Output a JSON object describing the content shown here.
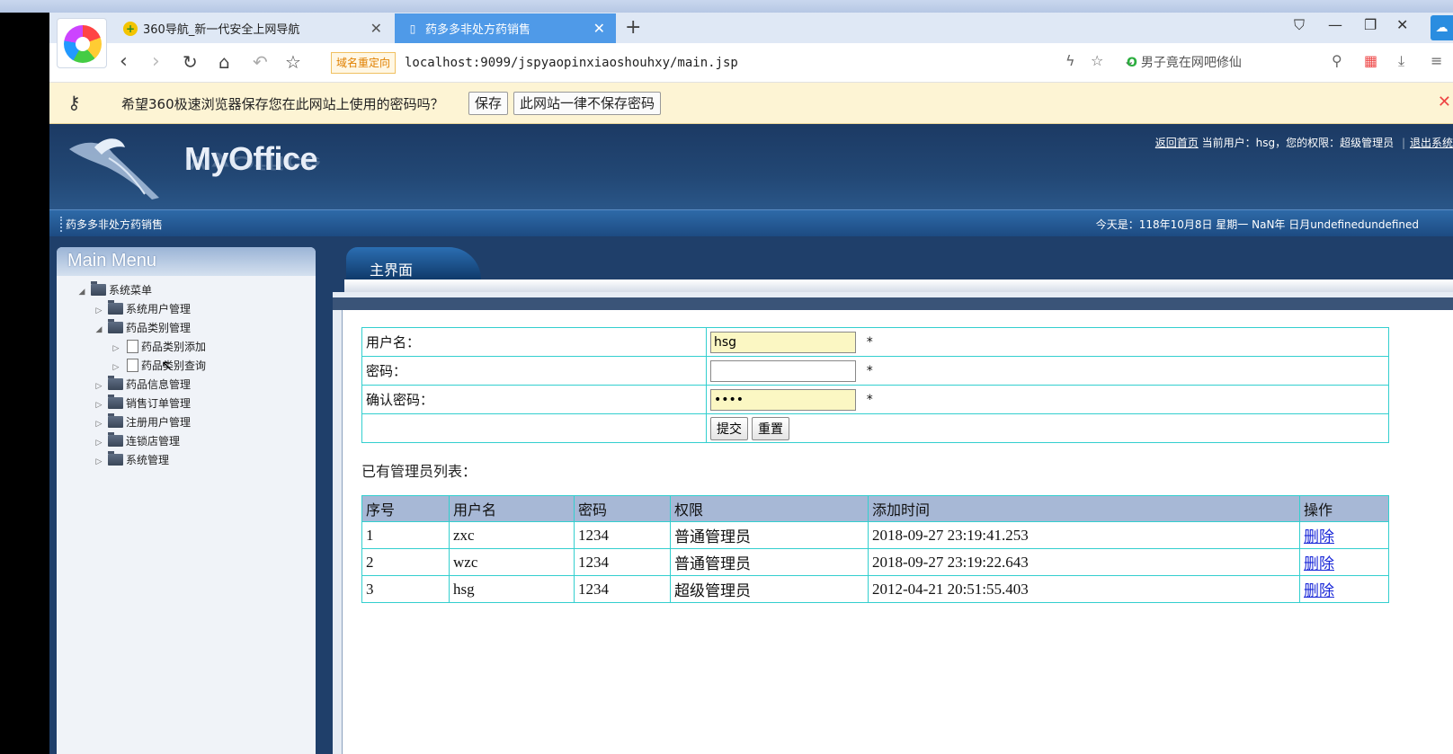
{
  "browser": {
    "tabs": [
      {
        "label": "360导航_新一代安全上网导航"
      },
      {
        "label": "药多多非处方药销售"
      }
    ],
    "redirect_badge": "域名重定向",
    "url": "localhost:9099/jspyaopinxiaoshouhxy/main.jsp",
    "search_text": "男子竟在网吧修仙",
    "password_prompt": "希望360极速浏览器保存您在此网站上使用的密码吗？",
    "password_save": "保存",
    "password_never": "此网站一律不保存密码"
  },
  "app": {
    "brand": "MyOffice",
    "user_links": {
      "home": "返回首页",
      "current_user": "当前用户：hsg，您的权限：超级管理员",
      "logout": "退出系统"
    },
    "site_title": "药多多非处方药销售",
    "date_text": "今天是：118年10月8日 星期一 NaN年 日月undefinedundefined"
  },
  "menu": {
    "title": "Main Menu",
    "root": "系统菜单",
    "items": [
      {
        "label": "系统用户管理"
      },
      {
        "label": "药品类别管理"
      },
      {
        "label": "药品类别添加"
      },
      {
        "label": "药品类别查询"
      },
      {
        "label": "药品信息管理"
      },
      {
        "label": "销售订单管理"
      },
      {
        "label": "注册用户管理"
      },
      {
        "label": "连锁店管理"
      },
      {
        "label": "系统管理"
      }
    ]
  },
  "main": {
    "tab": "主界面",
    "form": {
      "username_label": "用户名：",
      "username_value": "hsg",
      "password_label": "密码：",
      "password_value": "",
      "confirm_label": "确认密码：",
      "confirm_value": "••••",
      "required": "*",
      "submit": "提交",
      "reset": "重置"
    },
    "list_title": "已有管理员列表：",
    "table": {
      "headers": [
        "序号",
        "用户名",
        "密码",
        "权限",
        "添加时间",
        "操作"
      ],
      "rows": [
        [
          "1",
          "zxc",
          "1234",
          "普通管理员",
          "2018-09-27 23:19:41.253",
          "删除"
        ],
        [
          "2",
          "wzc",
          "1234",
          "普通管理员",
          "2018-09-27 23:19:22.643",
          "删除"
        ],
        [
          "3",
          "hsg",
          "1234",
          "超级管理员",
          "2012-04-21 20:51:55.403",
          "删除"
        ]
      ]
    }
  }
}
